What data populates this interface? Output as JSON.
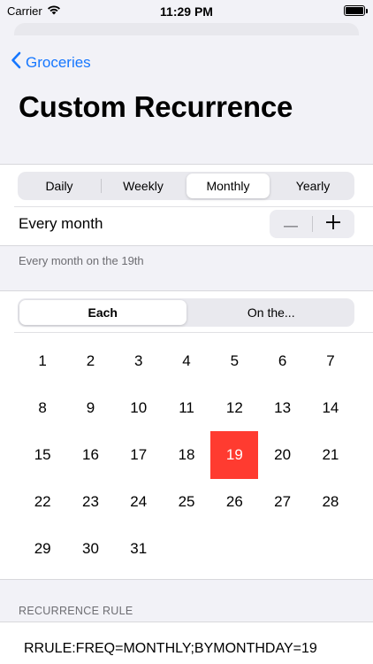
{
  "status_bar": {
    "carrier": "Carrier",
    "time": "11:29 PM"
  },
  "nav": {
    "back_label": "Groceries"
  },
  "page": {
    "title": "Custom Recurrence"
  },
  "frequency": {
    "options": [
      "Daily",
      "Weekly",
      "Monthly",
      "Yearly"
    ],
    "selected": "Monthly"
  },
  "interval": {
    "label": "Every month",
    "decrement_symbol": "—",
    "increment_symbol": "+"
  },
  "summary": "Every month on the 19th",
  "mode": {
    "options": [
      "Each",
      "On the..."
    ],
    "selected": "Each"
  },
  "calendar": {
    "days": [
      "1",
      "2",
      "3",
      "4",
      "5",
      "6",
      "7",
      "8",
      "9",
      "10",
      "11",
      "12",
      "13",
      "14",
      "15",
      "16",
      "17",
      "18",
      "19",
      "20",
      "21",
      "22",
      "23",
      "24",
      "25",
      "26",
      "27",
      "28",
      "29",
      "30",
      "31"
    ],
    "selected_day": "19"
  },
  "rule": {
    "header": "RECURRENCE RULE",
    "value": "RRULE:FREQ=MONTHLY;BYMONTHDAY=19"
  },
  "colors": {
    "accent": "#1677ff",
    "selected_day": "#ff3b30"
  }
}
